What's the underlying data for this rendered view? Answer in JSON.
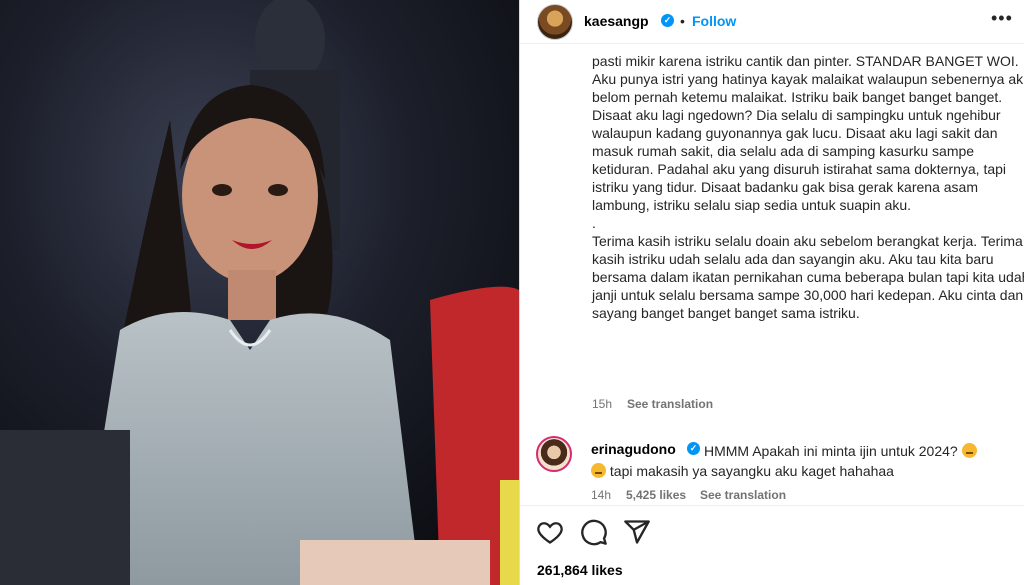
{
  "post": {
    "author": "kaesangp",
    "follow_label": "Follow",
    "more_label": "•••",
    "caption": [
      "pasti mikir karena istriku cantik dan pinter. STANDAR BANGET WOI. Aku punya istri yang hatinya kayak malaikat walaupun sebenernya aku belom pernah ketemu malaikat. Istriku baik banget banget banget. Disaat aku lagi ngedown? Dia selalu di sampingku untuk ngehibur walaupun kadang guyonannya gak lucu. Disaat aku lagi sakit dan masuk rumah sakit, dia selalu ada di samping kasurku sampe ketiduran. Padahal aku yang disuruh istirahat sama dokternya, tapi istriku yang tidur. Disaat badanku gak bisa gerak karena asam lambung, istriku selalu siap sedia untuk suapin aku.",
      ".",
      "Terima kasih istriku selalu doain aku sebelom berangkat kerja. Terima kasih istriku udah selalu ada dan sayangin aku. Aku tau kita baru bersama dalam ikatan pernikahan cuma beberapa bulan tapi kita udah janji untuk selalu bersama sampe 30,000 hari kedepan. Aku cinta dan sayang banget banget banget sama istriku."
    ],
    "time": "15h",
    "see_translation": "See translation",
    "likes": "261,864 likes"
  },
  "comment": {
    "author": "erinagudono",
    "text": "HMMM Apakah ini minta ijin untuk 2024? tapi makasih ya sayangku aku kaget hahahaa",
    "text_part1": "HMMM Apakah ini minta ijin untuk 2024?",
    "text_part2": "tapi makasih ya sayangku aku kaget hahahaa",
    "time": "14h",
    "likes": "5,425 likes",
    "see_translation": "See translation"
  },
  "icons": [
    "verified-badge-icon",
    "heart-icon",
    "comment-icon",
    "share-icon",
    "thinking-emoji-icon"
  ],
  "colors": {
    "link_blue": "#0095f6",
    "verified_blue": "#0095f6",
    "meta_gray": "#737373"
  }
}
